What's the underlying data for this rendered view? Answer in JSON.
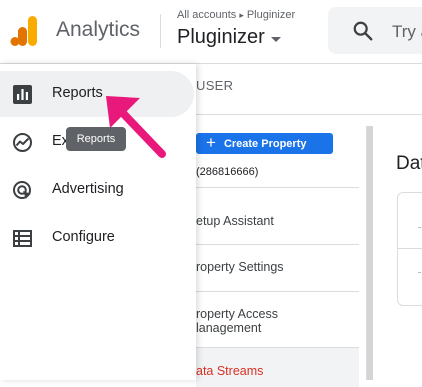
{
  "header": {
    "app_title": "Analytics",
    "breadcrumb": {
      "root": "All accounts",
      "separator": "▸",
      "current": "Pluginizer"
    },
    "account_name": "Pluginizer",
    "search": {
      "placeholder": "Try a"
    }
  },
  "admin": {
    "property_tab": "USER",
    "create_property_label": "Create Property",
    "property_id": "(286816666)",
    "property_menu": [
      {
        "label": "etup Assistant"
      },
      {
        "label": "roperty Settings"
      },
      {
        "label": "roperty Access",
        "label2": "lanagement"
      },
      {
        "label": "ata Streams",
        "active": true
      }
    ],
    "right_heading": "Dat"
  },
  "nav": {
    "items": [
      {
        "label": "Reports",
        "icon": "bar-chart-icon",
        "selected": true
      },
      {
        "label": "Explore",
        "icon": "explore-icon"
      },
      {
        "label": "Advertising",
        "icon": "advertising-icon"
      },
      {
        "label": "Configure",
        "icon": "configure-icon"
      }
    ]
  },
  "tooltip": {
    "text": "Reports"
  },
  "colors": {
    "accent_blue": "#1a73e8",
    "logo_orange": "#f9ab00",
    "logo_dark_orange": "#e37400",
    "arrow_pink": "#e8197a",
    "active_red": "#d93025",
    "tooltip_bg": "#5f6368"
  }
}
